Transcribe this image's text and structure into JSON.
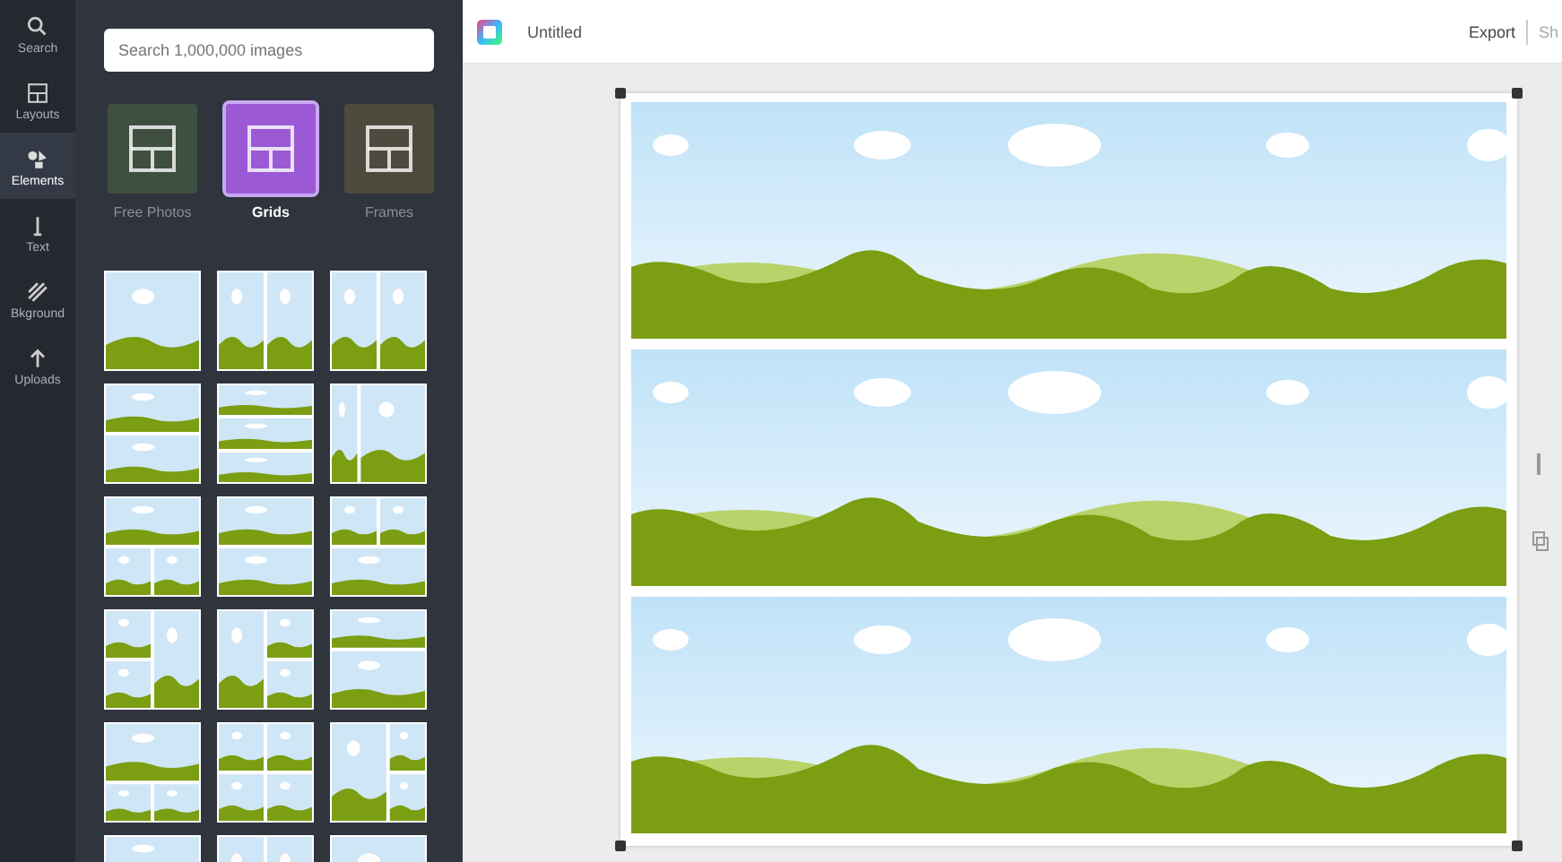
{
  "sidebar": {
    "items": [
      {
        "label": "Search",
        "kind": "search",
        "selected": false
      },
      {
        "label": "Layouts",
        "kind": "layouts",
        "selected": false
      },
      {
        "label": "Elements",
        "kind": "elements",
        "selected": true
      },
      {
        "label": "Text",
        "kind": "text",
        "selected": false
      },
      {
        "label": "Bkground",
        "kind": "background",
        "selected": false
      },
      {
        "label": "Uploads",
        "kind": "uploads",
        "selected": false
      }
    ]
  },
  "panel": {
    "search": {
      "placeholder": "Search 1,000,000 images"
    },
    "categories": [
      {
        "label": "Free Photos",
        "color": "#3f4f40",
        "selected": false
      },
      {
        "label": "Grids",
        "color": "#9b59d6",
        "selected": true
      },
      {
        "label": "Frames",
        "color": "#4e4a3e",
        "selected": false
      }
    ]
  },
  "topbar": {
    "title": "Untitled",
    "actions": [
      "Export",
      "Sh"
    ]
  }
}
